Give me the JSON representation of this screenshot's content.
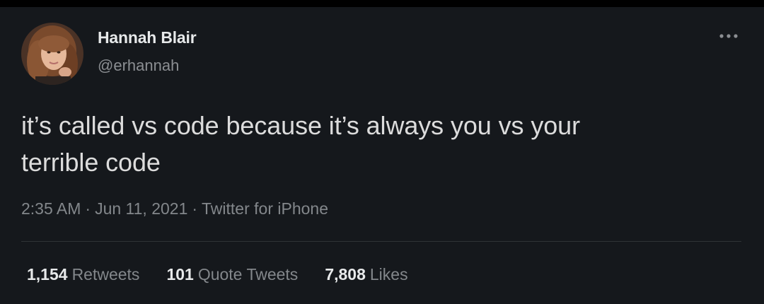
{
  "tweet": {
    "author": {
      "name": "Hannah Blair",
      "handle": "@erhannah"
    },
    "text_line1": "it’s called vs code because it’s always you vs your",
    "text_line2": "terrible code",
    "time": "2:35 AM",
    "date": "Jun 11, 2021",
    "separator": "·",
    "source": "Twitter for iPhone",
    "more_icon": "ellipsis-icon",
    "stats": {
      "retweets": {
        "count": "1,154",
        "label": "Retweets"
      },
      "quote_tweets": {
        "count": "101",
        "label": "Quote Tweets"
      },
      "likes": {
        "count": "7,808",
        "label": "Likes"
      }
    }
  },
  "colors": {
    "background": "#15181c",
    "text": "#dcdcdc",
    "secondary": "#83878b",
    "divider": "#2f3336"
  }
}
